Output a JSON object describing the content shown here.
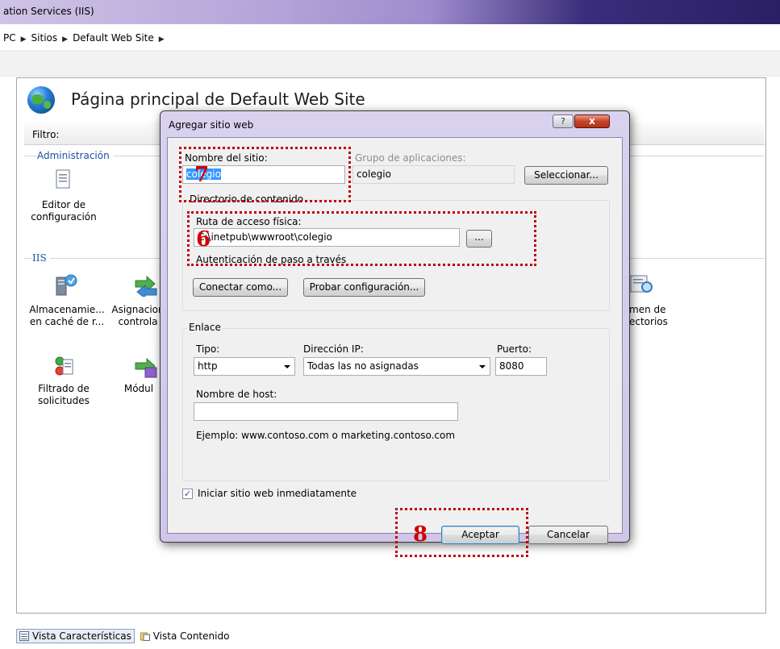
{
  "window": {
    "title": "ation Services (IIS)"
  },
  "breadcrumb": [
    "PC",
    "Sitios",
    "Default Web Site"
  ],
  "page": {
    "title": "Página principal de Default Web Site",
    "filter_label": "Filtro:"
  },
  "groups": {
    "admin": "Administración",
    "iis": "IIS"
  },
  "features": {
    "editor": "Editor de\nconfiguración",
    "cache": "Almacenamie...\nen caché de r...",
    "mappings": "Asignacion\ncontrola",
    "filtering": "Filtrado de\nsolicitudes",
    "modules": "Módul",
    "directory": "men de\nectorios"
  },
  "bottom_tabs": {
    "features": "Vista Características",
    "content": "Vista Contenido"
  },
  "dialog": {
    "title": "Agregar sitio web",
    "help": "?",
    "close": "x",
    "site_name_label": "Nombre del sitio:",
    "site_name_value": "colegio",
    "app_pool_label": "Grupo de aplicaciones:",
    "app_pool_value": "colegio",
    "select_button": "Seleccionar...",
    "content_dir_label": "Directorio de contenido",
    "physical_path_label": "Ruta de acceso física:",
    "physical_path_value": "C:\\inetpub\\wwwroot\\colegio",
    "browse_button": "...",
    "pass_through_label": "Autenticación de paso a través",
    "connect_as_button": "Conectar como...",
    "test_settings_button": "Probar configuración...",
    "binding_label": "Enlace",
    "type_label": "Tipo:",
    "type_value": "http",
    "ip_label": "Dirección IP:",
    "ip_value": "Todas las no asignadas",
    "port_label": "Puerto:",
    "port_value": "8080",
    "host_label": "Nombre de host:",
    "host_value": "",
    "example": "Ejemplo: www.contoso.com o marketing.contoso.com",
    "start_immediately": "Iniciar sitio web inmediatamente",
    "start_checked": "✓",
    "ok_button": "Aceptar",
    "cancel_button": "Cancelar"
  },
  "annotations": {
    "n6": "6",
    "n7": "7",
    "n8": "8"
  }
}
